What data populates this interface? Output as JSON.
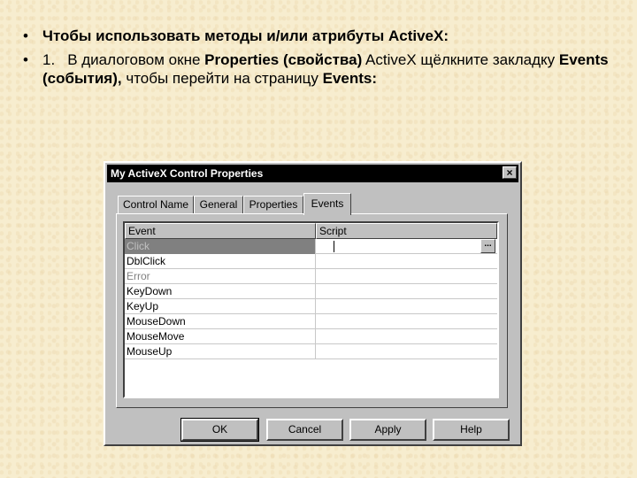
{
  "slide": {
    "bullet1": "Чтобы использовать методы и/или атрибуты ActiveX:",
    "bullet2": {
      "number": "1.",
      "text_before": "В диалоговом окне ",
      "properties_bold": "Properties (свойства)",
      "text_mid1": " ActiveX щёлкните закладку ",
      "events_bold": "Events (события),",
      "text_mid2": " чтобы перейти на страницу ",
      "events_page_bold": "Events:"
    }
  },
  "dialog": {
    "title": "My ActiveX Control Properties",
    "close_label": "×",
    "tabs": [
      "Control Name",
      "General",
      "Properties",
      "Events"
    ],
    "active_tab": "Events",
    "columns": [
      "Event",
      "Script"
    ],
    "events": [
      "Click",
      "DblClick",
      "Error",
      "KeyDown",
      "KeyUp",
      "MouseDown",
      "MouseMove",
      "MouseUp"
    ],
    "ellipsis_label": "...",
    "buttons": {
      "ok": "OK",
      "cancel": "Cancel",
      "apply": "Apply",
      "help": "Help"
    }
  }
}
